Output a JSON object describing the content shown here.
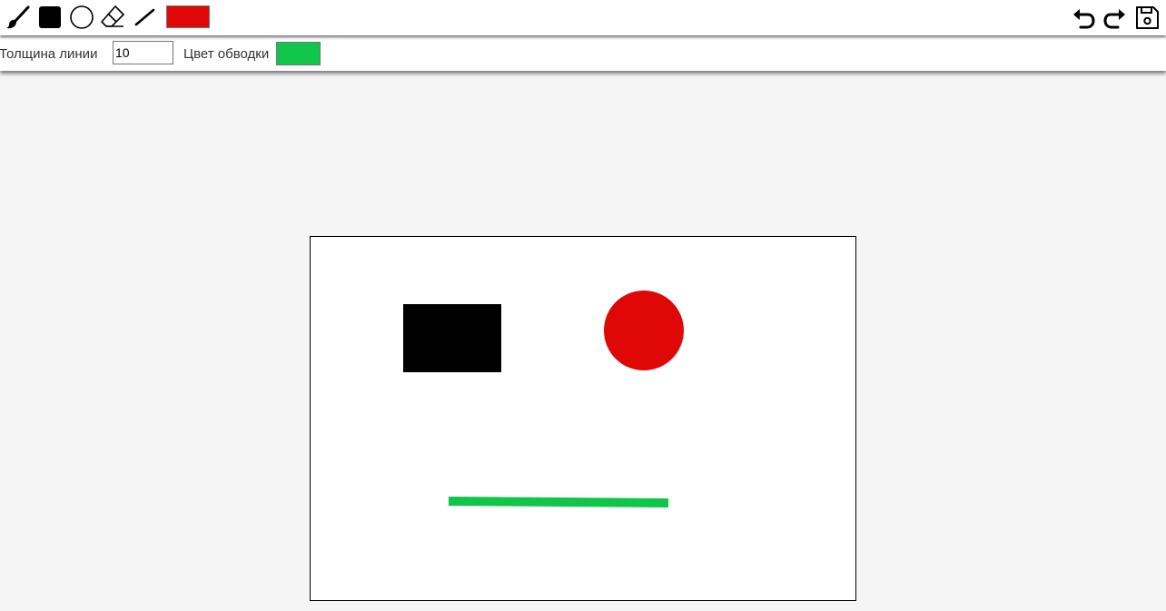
{
  "toolbar": {
    "tools": [
      {
        "id": "brush",
        "icon": "brush-icon"
      },
      {
        "id": "rectangle",
        "icon": "filled-square-icon"
      },
      {
        "id": "circle",
        "icon": "circle-outline-icon"
      },
      {
        "id": "eraser",
        "icon": "eraser-icon"
      },
      {
        "id": "line",
        "icon": "line-icon"
      }
    ],
    "fill_color": "#e00707",
    "actions": [
      {
        "id": "undo",
        "icon": "undo-icon"
      },
      {
        "id": "redo",
        "icon": "redo-icon"
      },
      {
        "id": "save",
        "icon": "save-icon"
      }
    ]
  },
  "options": {
    "thickness_label": "Толщина линии",
    "thickness_value": "10",
    "stroke_color_label": "Цвет обводки",
    "stroke_color": "#10c54a"
  },
  "canvas": {
    "background": "#ffffff",
    "shapes": [
      {
        "type": "rectangle",
        "fill": "#000000"
      },
      {
        "type": "circle",
        "fill": "#e00707"
      },
      {
        "type": "line",
        "stroke": "#10c54a"
      }
    ]
  }
}
